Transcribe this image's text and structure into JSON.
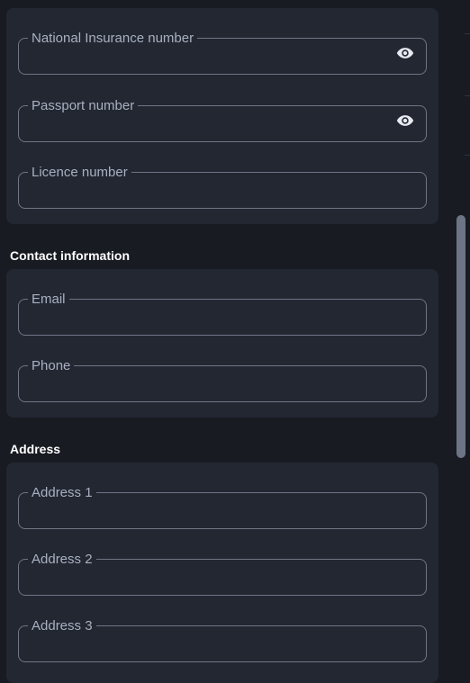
{
  "identity": {
    "fields": [
      {
        "label": "National Insurance number",
        "value": "",
        "icon": "eye-icon"
      },
      {
        "label": "Passport number",
        "value": "",
        "icon": "eye-icon"
      },
      {
        "label": "Licence number",
        "value": ""
      }
    ]
  },
  "contact": {
    "title": "Contact information",
    "fields": [
      {
        "label": "Email",
        "value": ""
      },
      {
        "label": "Phone",
        "value": ""
      }
    ]
  },
  "address": {
    "title": "Address",
    "fields": [
      {
        "label": "Address 1",
        "value": ""
      },
      {
        "label": "Address 2",
        "value": ""
      },
      {
        "label": "Address 3",
        "value": ""
      }
    ]
  },
  "colors": {
    "background": "#181b22",
    "card": "#222732",
    "field_border": "#6f7585",
    "label": "#a9b0c0",
    "scrollbar_thumb": "#6d7485"
  }
}
